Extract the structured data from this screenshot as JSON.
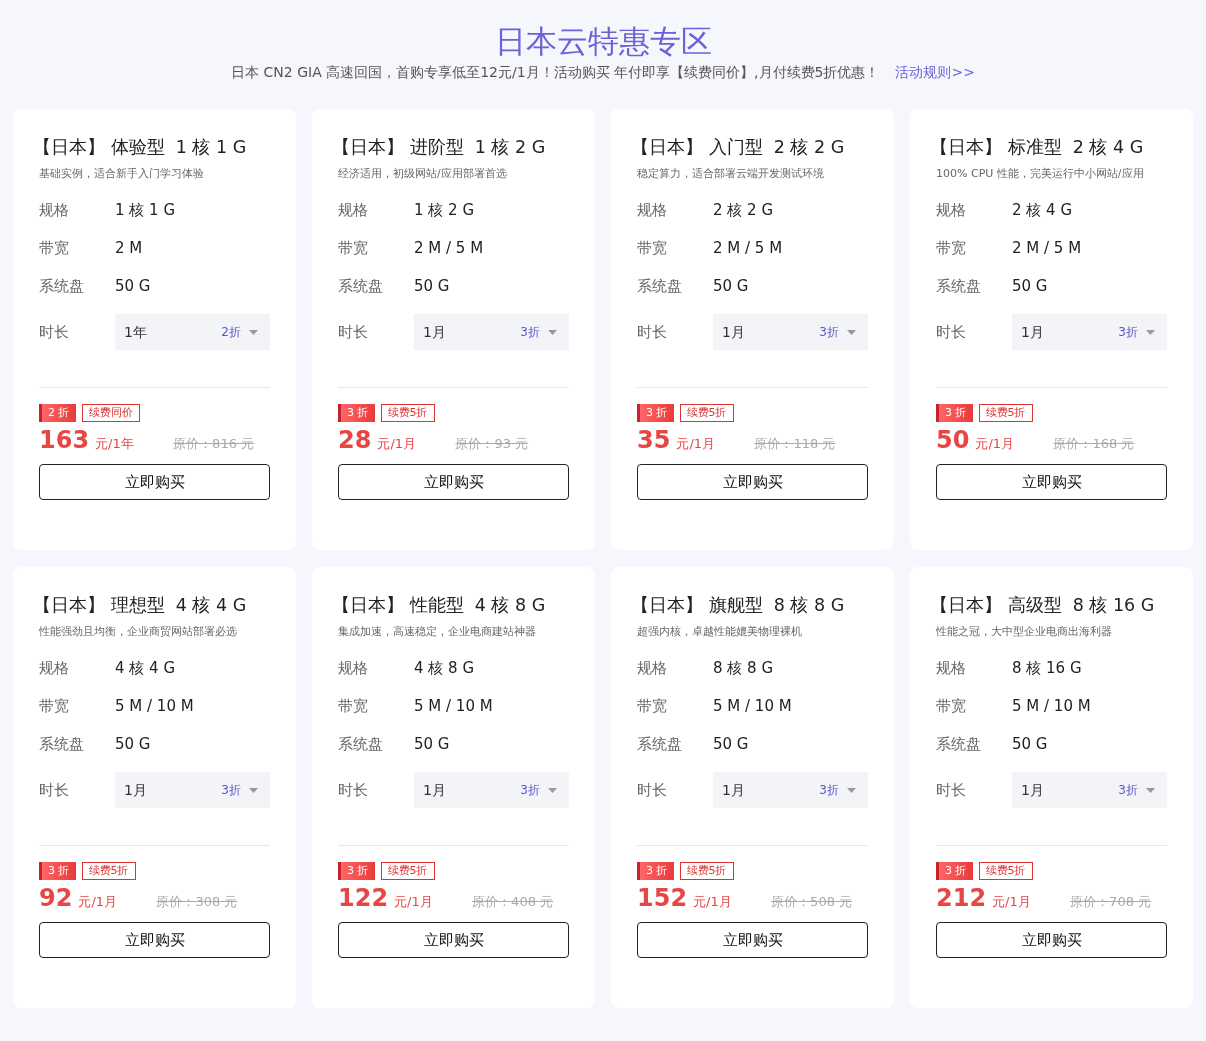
{
  "header": {
    "title": "日本云特惠专区",
    "subtitle": "日本 CN2 GIA 高速回国，首购专享低至12元/1月！活动购买 年付即享【续费同价】,月付续费5折优惠！",
    "rules_link": "活动规则>>"
  },
  "plans": [
    {
      "title": "【日本】 体验型  1 核 1 G",
      "description": "基础实例，适合新手入门学习体验",
      "specs": [
        {
          "label": "规格",
          "value": "1 核 1 G"
        },
        {
          "label": "带宽",
          "value": "2 M"
        },
        {
          "label": "系统盘",
          "value": "50 G"
        }
      ],
      "duration": {
        "label": "时长",
        "value": "1年",
        "discount": "2折"
      },
      "discount_tag": "2 折",
      "renew_tag": "续费同价",
      "price": "163",
      "unit": "元/1年",
      "original_price": "原价：816 元",
      "buy_button": "立即购买"
    },
    {
      "title": "【日本】 进阶型  1 核 2 G",
      "description": "经济适用，初级网站/应用部署首选",
      "specs": [
        {
          "label": "规格",
          "value": "1 核 2 G"
        },
        {
          "label": "带宽",
          "value": "2 M / 5 M"
        },
        {
          "label": "系统盘",
          "value": "50 G"
        }
      ],
      "duration": {
        "label": "时长",
        "value": "1月",
        "discount": "3折"
      },
      "discount_tag": "3 折",
      "renew_tag": "续费5折",
      "price": "28",
      "unit": "元/1月",
      "original_price": "原价：93 元",
      "buy_button": "立即购买"
    },
    {
      "title": "【日本】 入门型  2 核 2 G",
      "description": "稳定算力，适合部署云端开发测试环境",
      "specs": [
        {
          "label": "规格",
          "value": "2 核 2 G"
        },
        {
          "label": "带宽",
          "value": "2 M / 5 M"
        },
        {
          "label": "系统盘",
          "value": "50 G"
        }
      ],
      "duration": {
        "label": "时长",
        "value": "1月",
        "discount": "3折"
      },
      "discount_tag": "3 折",
      "renew_tag": "续费5折",
      "price": "35",
      "unit": "元/1月",
      "original_price": "原价：118 元",
      "buy_button": "立即购买"
    },
    {
      "title": "【日本】 标准型  2 核 4 G",
      "description": "100% CPU 性能，完美运行中小网站/应用",
      "specs": [
        {
          "label": "规格",
          "value": "2 核 4 G"
        },
        {
          "label": "带宽",
          "value": "2 M / 5 M"
        },
        {
          "label": "系统盘",
          "value": "50 G"
        }
      ],
      "duration": {
        "label": "时长",
        "value": "1月",
        "discount": "3折"
      },
      "discount_tag": "3 折",
      "renew_tag": "续费5折",
      "price": "50",
      "unit": "元/1月",
      "original_price": "原价：168 元",
      "buy_button": "立即购买"
    },
    {
      "title": "【日本】 理想型  4 核 4 G",
      "description": "性能强劲且均衡，企业商贸网站部署必选",
      "specs": [
        {
          "label": "规格",
          "value": "4 核 4 G"
        },
        {
          "label": "带宽",
          "value": "5 M / 10 M"
        },
        {
          "label": "系统盘",
          "value": "50 G"
        }
      ],
      "duration": {
        "label": "时长",
        "value": "1月",
        "discount": "3折"
      },
      "discount_tag": "3 折",
      "renew_tag": "续费5折",
      "price": "92",
      "unit": "元/1月",
      "original_price": "原价：308 元",
      "buy_button": "立即购买"
    },
    {
      "title": "【日本】 性能型  4 核 8 G",
      "description": "集成加速，高速稳定，企业电商建站神器",
      "specs": [
        {
          "label": "规格",
          "value": "4 核 8 G"
        },
        {
          "label": "带宽",
          "value": "5 M / 10 M"
        },
        {
          "label": "系统盘",
          "value": "50 G"
        }
      ],
      "duration": {
        "label": "时长",
        "value": "1月",
        "discount": "3折"
      },
      "discount_tag": "3 折",
      "renew_tag": "续费5折",
      "price": "122",
      "unit": "元/1月",
      "original_price": "原价：408 元",
      "buy_button": "立即购买"
    },
    {
      "title": "【日本】 旗舰型  8 核 8 G",
      "description": "超强内核，卓越性能媲美物理裸机",
      "specs": [
        {
          "label": "规格",
          "value": "8 核 8 G"
        },
        {
          "label": "带宽",
          "value": "5 M / 10 M"
        },
        {
          "label": "系统盘",
          "value": "50 G"
        }
      ],
      "duration": {
        "label": "时长",
        "value": "1月",
        "discount": "3折"
      },
      "discount_tag": "3 折",
      "renew_tag": "续费5折",
      "price": "152",
      "unit": "元/1月",
      "original_price": "原价：508 元",
      "buy_button": "立即购买"
    },
    {
      "title": "【日本】 高级型  8 核 16 G",
      "description": "性能之冠，大中型企业电商出海利器",
      "specs": [
        {
          "label": "规格",
          "value": "8 核 16 G"
        },
        {
          "label": "带宽",
          "value": "5 M / 10 M"
        },
        {
          "label": "系统盘",
          "value": "50 G"
        }
      ],
      "duration": {
        "label": "时长",
        "value": "1月",
        "discount": "3折"
      },
      "discount_tag": "3 折",
      "renew_tag": "续费5折",
      "price": "212",
      "unit": "元/1月",
      "original_price": "原价：708 元",
      "buy_button": "立即购买"
    }
  ]
}
